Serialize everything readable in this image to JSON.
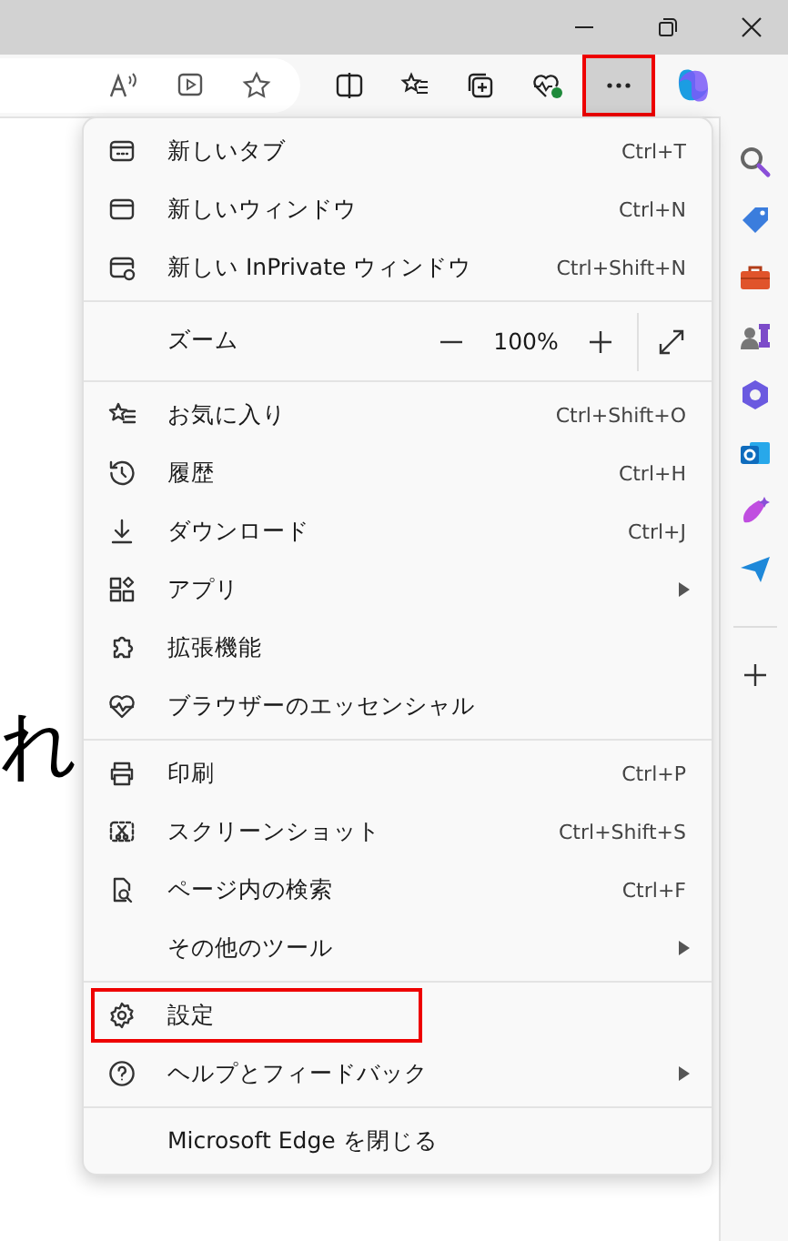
{
  "toolbar": {
    "more_button": {
      "highlighted": true
    }
  },
  "page": {
    "text": "れ"
  },
  "menu": {
    "groups": [
      [
        {
          "kind": "item",
          "label": "新しいタブ",
          "shortcut": "Ctrl+T",
          "submenu": false,
          "highlighted": false
        },
        {
          "kind": "item",
          "label": "新しいウィンドウ",
          "shortcut": "Ctrl+N",
          "submenu": false,
          "highlighted": false
        },
        {
          "kind": "item",
          "label": "新しい InPrivate ウィンドウ",
          "shortcut": "Ctrl+Shift+N",
          "submenu": false,
          "highlighted": false
        }
      ],
      [
        {
          "kind": "zoom",
          "label": "ズーム",
          "value": "100%"
        }
      ],
      [
        {
          "kind": "item",
          "label": "お気に入り",
          "shortcut": "Ctrl+Shift+O",
          "submenu": false,
          "highlighted": false
        },
        {
          "kind": "item",
          "label": "履歴",
          "shortcut": "Ctrl+H",
          "submenu": false,
          "highlighted": false
        },
        {
          "kind": "item",
          "label": "ダウンロード",
          "shortcut": "Ctrl+J",
          "submenu": false,
          "highlighted": false
        },
        {
          "kind": "item",
          "label": "アプリ",
          "submenu": true,
          "highlighted": false
        },
        {
          "kind": "item",
          "label": "拡張機能",
          "submenu": false,
          "highlighted": false
        },
        {
          "kind": "item",
          "label": "ブラウザーのエッセンシャル",
          "submenu": false,
          "highlighted": false
        }
      ],
      [
        {
          "kind": "item",
          "label": "印刷",
          "shortcut": "Ctrl+P",
          "submenu": false,
          "highlighted": false
        },
        {
          "kind": "item",
          "label": "スクリーンショット",
          "shortcut": "Ctrl+Shift+S",
          "submenu": false,
          "highlighted": false
        },
        {
          "kind": "item",
          "label": "ページ内の検索",
          "shortcut": "Ctrl+F",
          "submenu": false,
          "highlighted": false
        },
        {
          "kind": "item",
          "label": "その他のツール",
          "submenu": true,
          "highlighted": false
        }
      ],
      [
        {
          "kind": "item",
          "label": "設定",
          "submenu": false,
          "highlighted": true
        },
        {
          "kind": "item",
          "label": "ヘルプとフィードバック",
          "submenu": true,
          "highlighted": false
        }
      ],
      [
        {
          "kind": "item",
          "label": "Microsoft Edge を閉じる",
          "submenu": false,
          "highlighted": false
        }
      ]
    ]
  }
}
